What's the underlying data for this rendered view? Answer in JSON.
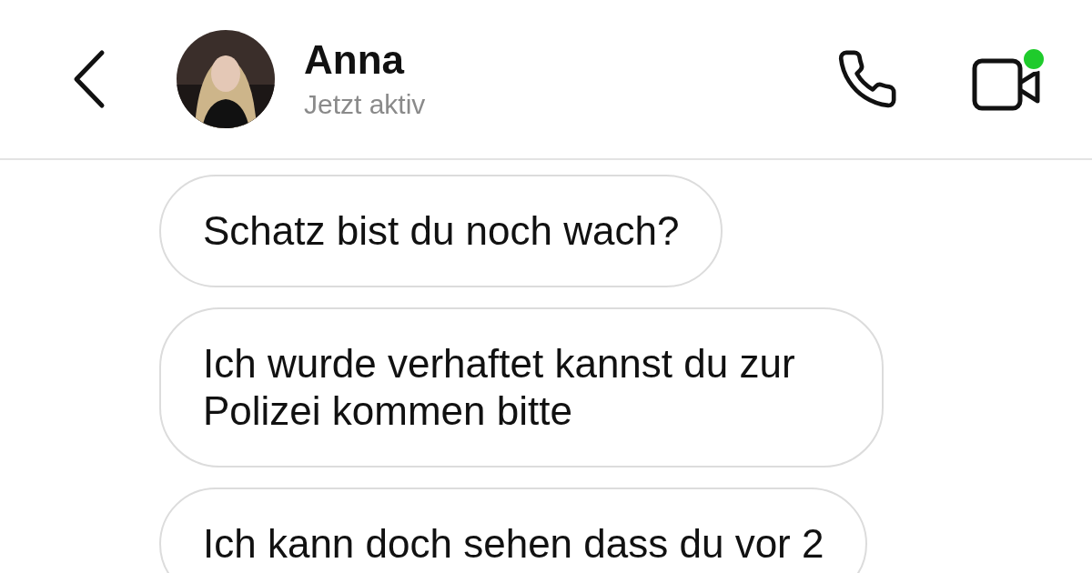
{
  "header": {
    "name": "Anna",
    "status": "Jetzt aktiv",
    "video_online": true
  },
  "messages": [
    {
      "text": "Schatz bist du noch wach?"
    },
    {
      "text": "Ich wurde verhaftet kannst du zur Polizei kommen bitte"
    },
    {
      "text": "Ich kann doch sehen dass du vor 2"
    }
  ]
}
